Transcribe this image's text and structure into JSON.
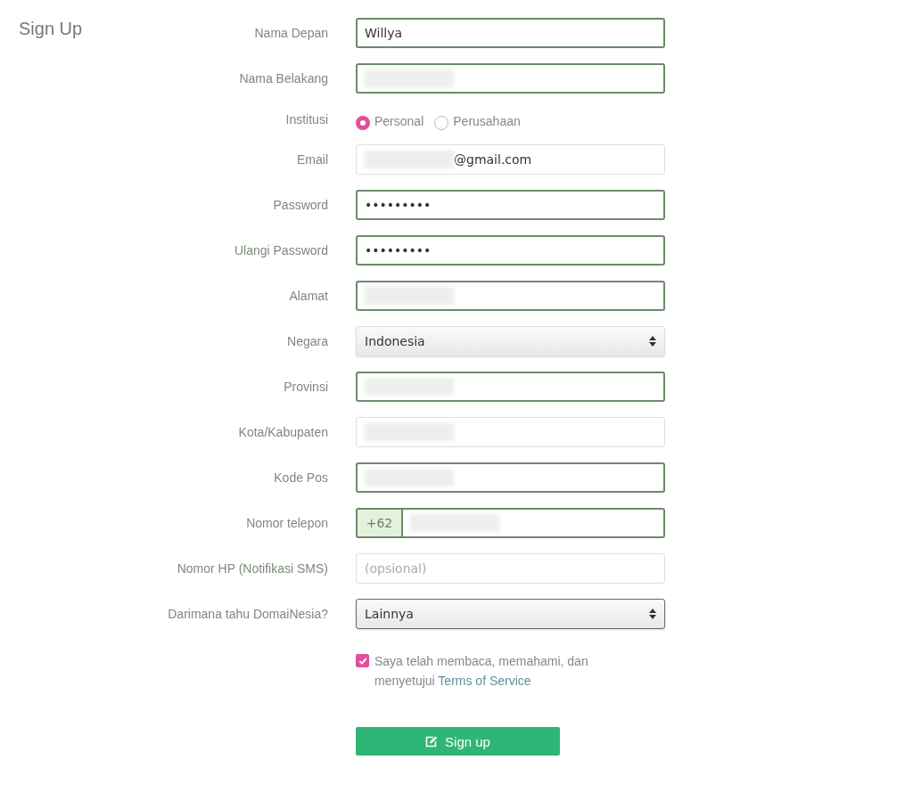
{
  "title": "Sign Up",
  "fields": [
    {
      "kind": "text",
      "label": "Nama Depan",
      "value": "Willya",
      "valid": true
    },
    {
      "kind": "text",
      "label": "Nama Belakang",
      "redacted": true,
      "valid": true
    },
    {
      "kind": "radio",
      "label": "Institusi",
      "options": [
        {
          "label": "Personal",
          "selected": true
        },
        {
          "label": "Perusahaan",
          "selected": false
        }
      ]
    },
    {
      "kind": "text",
      "label": "Email",
      "value": "@gmail.com",
      "redacted": true,
      "valid": false
    },
    {
      "kind": "password",
      "label": "Password",
      "value": "•••••••••",
      "valid": true
    },
    {
      "kind": "password",
      "label": "Ulangi Password",
      "value": "•••••••••",
      "valid": true
    },
    {
      "kind": "text",
      "label": "Alamat",
      "redacted": true,
      "valid": true
    },
    {
      "kind": "select",
      "label": "Negara",
      "value": "Indonesia",
      "valid": false
    },
    {
      "kind": "text",
      "label": "Provinsi",
      "redacted": true,
      "valid": true
    },
    {
      "kind": "text",
      "label": "Kota/Kabupaten",
      "redacted": true,
      "valid": false
    },
    {
      "kind": "text",
      "label": "Kode Pos",
      "redacted": true,
      "valid": true
    },
    {
      "kind": "phone",
      "label": "Nomor telepon",
      "prefix": "+62",
      "redacted": true,
      "valid": true
    },
    {
      "kind": "text",
      "label": "Nomor HP (Notifikasi SMS)",
      "placeholder": "(opsional)",
      "valid": false
    },
    {
      "kind": "select",
      "label": "Darimana tahu DomaiNesia?",
      "value": "Lainnya",
      "valid": true
    }
  ],
  "agreement": {
    "checked": true,
    "text": "Saya telah membaca, memahami, dan menyetujui",
    "link": "Terms of Service"
  },
  "submit": {
    "label": "Sign up"
  }
}
